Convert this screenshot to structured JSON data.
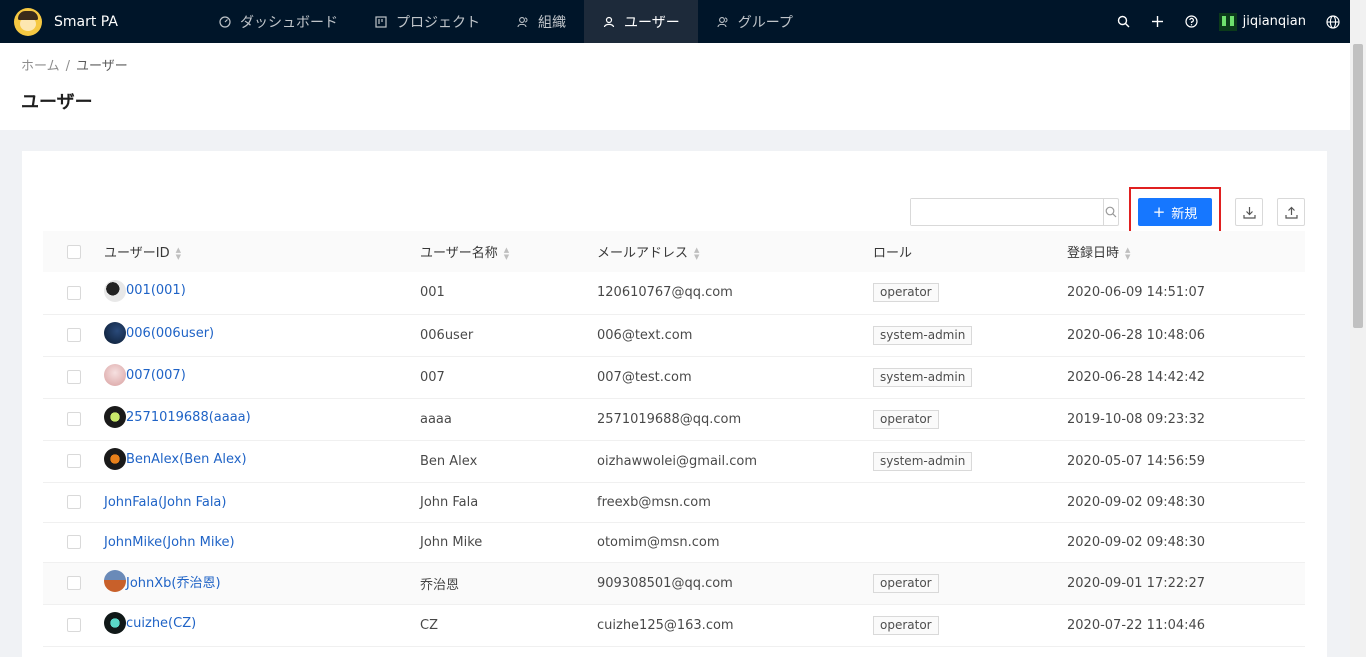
{
  "app": {
    "title": "Smart PA"
  },
  "nav": {
    "items": [
      {
        "label": "ダッシュボード",
        "icon": "dashboard-icon"
      },
      {
        "label": "プロジェクト",
        "icon": "project-icon"
      },
      {
        "label": "組織",
        "icon": "organization-icon"
      },
      {
        "label": "ユーザー",
        "icon": "user-icon"
      },
      {
        "label": "グループ",
        "icon": "group-icon"
      }
    ],
    "active": "ユーザー",
    "username": "jiqianqian"
  },
  "breadcrumb": {
    "home": "ホーム",
    "separator": "/",
    "current": "ユーザー"
  },
  "page": {
    "title": "ユーザー"
  },
  "toolbar": {
    "search_placeholder": "",
    "new_label": "新規"
  },
  "table": {
    "headers": {
      "user_id": "ユーザーID",
      "user_name": "ユーザー名称",
      "email": "メールアドレス",
      "role": "ロール",
      "registered": "登録日時"
    },
    "rows": [
      {
        "user_id": "001(001)",
        "user_name": "001",
        "email": "120610767@qq.com",
        "role": "operator",
        "registered": "2020-06-09 14:51:07",
        "avatar": true
      },
      {
        "user_id": "006(006user)",
        "user_name": "006user",
        "email": "006@text.com",
        "role": "system-admin",
        "registered": "2020-06-28 10:48:06",
        "avatar": true
      },
      {
        "user_id": "007(007)",
        "user_name": "007",
        "email": "007@test.com",
        "role": "system-admin",
        "registered": "2020-06-28 14:42:42",
        "avatar": true
      },
      {
        "user_id": "2571019688(aaaa)",
        "user_name": "aaaa",
        "email": "2571019688@qq.com",
        "role": "operator",
        "registered": "2019-10-08 09:23:32",
        "avatar": true
      },
      {
        "user_id": "BenAlex(Ben Alex)",
        "user_name": "Ben Alex",
        "email": "oizhawwolei@gmail.com",
        "role": "system-admin",
        "registered": "2020-05-07 14:56:59",
        "avatar": true
      },
      {
        "user_id": "JohnFala(John Fala)",
        "user_name": "John Fala",
        "email": "freexb@msn.com",
        "role": "",
        "registered": "2020-09-02 09:48:30",
        "avatar": false
      },
      {
        "user_id": "JohnMike(John Mike)",
        "user_name": "John Mike",
        "email": "otomim@msn.com",
        "role": "",
        "registered": "2020-09-02 09:48:30",
        "avatar": false
      },
      {
        "user_id": "JohnXb(乔治恩)",
        "user_name": "乔治恩",
        "email": "909308501@qq.com",
        "role": "operator",
        "registered": "2020-09-01 17:22:27",
        "avatar": true
      },
      {
        "user_id": "cuizhe(CZ)",
        "user_name": "CZ",
        "email": "cuizhe125@163.com",
        "role": "operator",
        "registered": "2020-07-22 11:04:46",
        "avatar": true
      }
    ]
  },
  "colors": {
    "nav_bg": "#001529",
    "primary": "#1677ff",
    "link": "#1f63c6",
    "highlight_box": "#e02020"
  }
}
